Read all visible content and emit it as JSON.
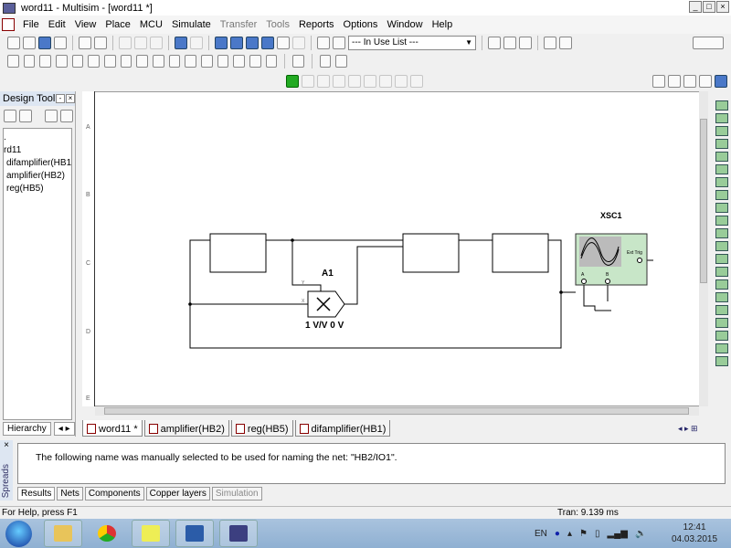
{
  "window": {
    "title": "word11 - Multisim - [word11 *]"
  },
  "menu": [
    "File",
    "Edit",
    "View",
    "Place",
    "MCU",
    "Simulate",
    "Transfer",
    "Tools",
    "Reports",
    "Options",
    "Window",
    "Help"
  ],
  "toolbar": {
    "in_use_list": "--- In Use List ---"
  },
  "design_toolbox": {
    "title": "Design Tool",
    "tree": [
      ".",
      "rd11",
      "difamplifier(HB1)",
      "amplifier(HB2)",
      "reg(HB5)"
    ],
    "tab": "Hierarchy"
  },
  "ruler": [
    "A",
    "B",
    "C",
    "D",
    "E"
  ],
  "schematic": {
    "multiplier_label": "A1",
    "multiplier_value": "1 V/V 0 V",
    "pin_y": "Y",
    "pin_x": "X",
    "scope_label": "XSC1",
    "scope_ext": "Ext Trig",
    "scope_a": "A",
    "scope_b": "B"
  },
  "sheet_tabs": [
    "word11 *",
    "amplifier(HB2)",
    "reg(HB5)",
    "difamplifier(HB1)"
  ],
  "spreadsheet": {
    "side_label": "Spreads",
    "message": "The following name was manually selected to be used for naming the net: \"HB2/IO1\".",
    "tabs": [
      "Results",
      "Nets",
      "Components",
      "Copper layers",
      "Simulation"
    ]
  },
  "status": {
    "help": "For Help, press F1",
    "tran": "Tran: 9.139 ms"
  },
  "taskbar": {
    "lang": "EN",
    "time": "12:41",
    "date": "04.03.2015"
  }
}
